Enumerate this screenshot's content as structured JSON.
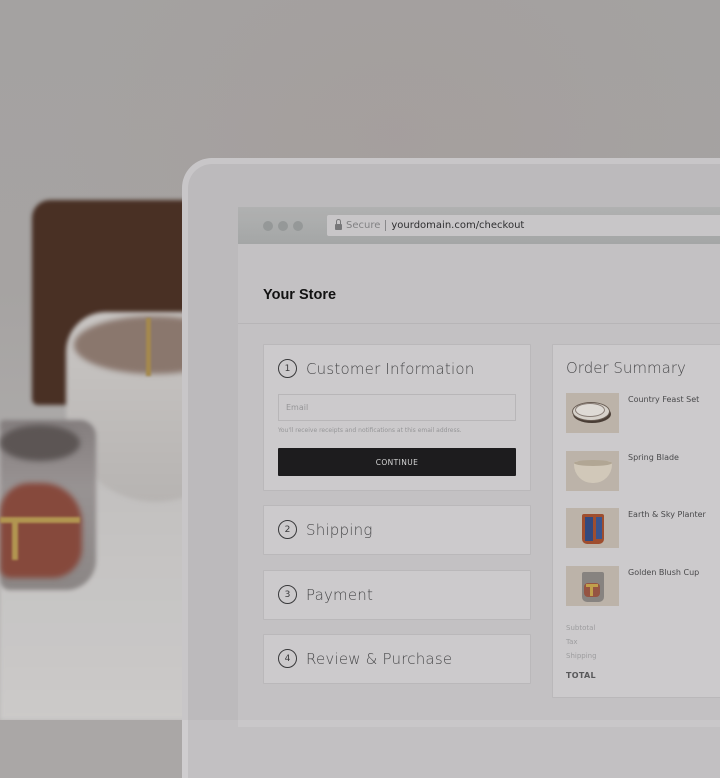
{
  "browser": {
    "secure_label": "Secure",
    "url": "yourdomain.com/checkout"
  },
  "store": {
    "title": "Your Store"
  },
  "checkout": {
    "steps": [
      {
        "number": "1",
        "label": "Customer Information"
      },
      {
        "number": "2",
        "label": "Shipping"
      },
      {
        "number": "3",
        "label": "Payment"
      },
      {
        "number": "4",
        "label": "Review & Purchase"
      }
    ],
    "email_placeholder": "Email",
    "email_hint": "You'll receive receipts and notifications at this email address.",
    "continue_label": "CONTINUE"
  },
  "order_summary": {
    "title": "Order Summary",
    "items": [
      {
        "name": "Country Feast Set",
        "icon": "plates-thumbnail"
      },
      {
        "name": "Spring Blade",
        "icon": "bowl-thumbnail"
      },
      {
        "name": "Earth & Sky Planter",
        "icon": "planter-thumbnail"
      },
      {
        "name": "Golden Blush Cup",
        "icon": "cup-thumbnail"
      }
    ],
    "subtotal_label": "Subtotal",
    "tax_label": "Tax",
    "shipping_label": "Shipping",
    "total_label": "TOTAL"
  },
  "colors": {
    "button_bg": "#1d1c1e",
    "page_bg": "#c9c7c9",
    "panel_bg": "#d3d1d3"
  }
}
